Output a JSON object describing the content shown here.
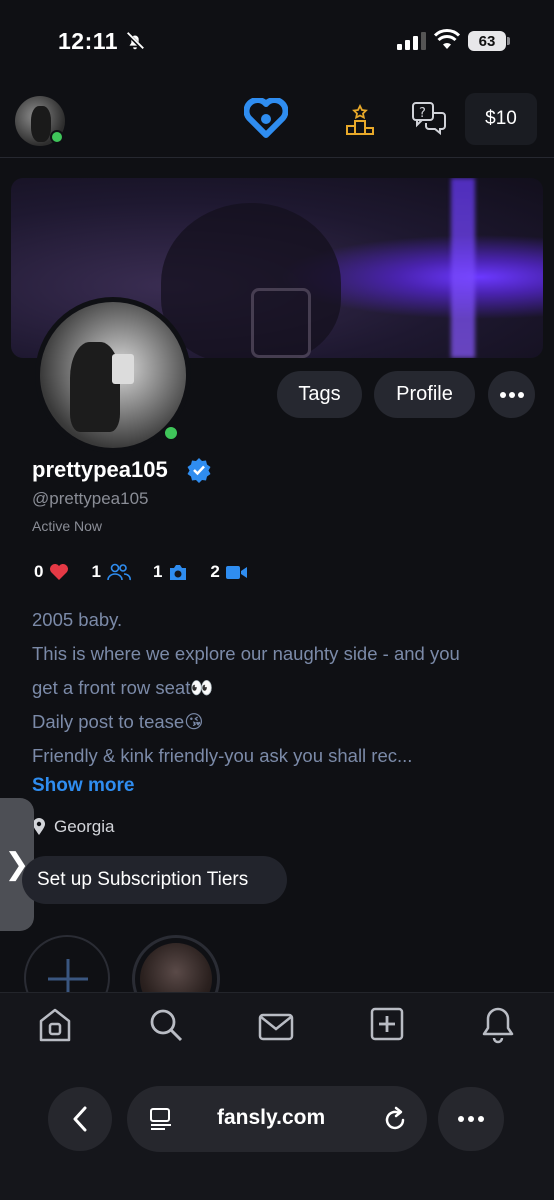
{
  "status": {
    "time": "12:11",
    "battery": "63"
  },
  "nav": {
    "wallet": "$10"
  },
  "profile": {
    "username": "prettypea105",
    "handle": "@prettypea105",
    "active": "Active Now",
    "buttons": {
      "tags": "Tags",
      "profile": "Profile"
    }
  },
  "stats": {
    "likes": "0",
    "subscribers": "1",
    "photos": "1",
    "videos": "2"
  },
  "bio": {
    "lines": [
      "2005 baby.",
      "This is where we explore our naughty side - and you",
      "get a front row seat👀",
      "Daily post to tease😘",
      "Friendly & kink friendly-you ask you shall rec..."
    ],
    "show_more": "Show more"
  },
  "location": "Georgia",
  "subscription_button": "Set up Subscription Tiers",
  "side_tab": "❯",
  "browser": {
    "url": "fansly.com"
  },
  "colors": {
    "accent": "#2f8df0",
    "online": "#3fc55a",
    "heart": "#e53945",
    "gold": "#e8a92a"
  }
}
